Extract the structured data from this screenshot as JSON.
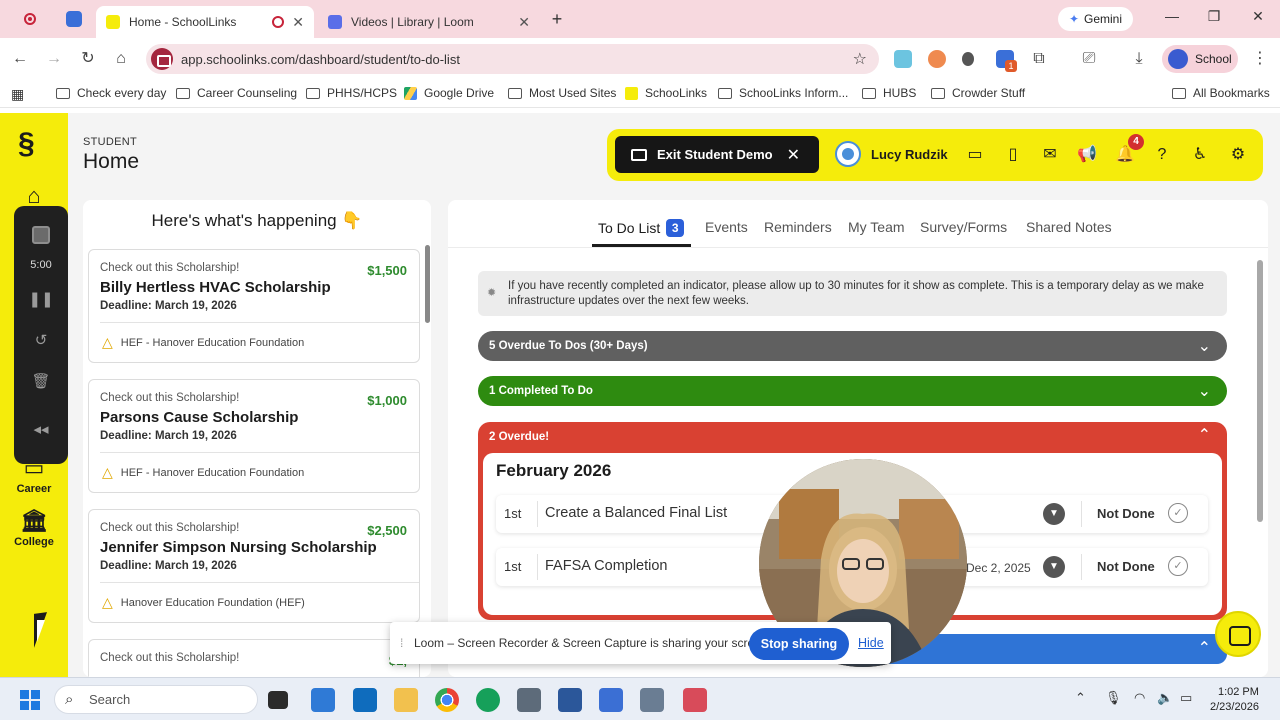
{
  "browser": {
    "tabs": [
      {
        "title": "Home - SchoolLinks",
        "active": true
      },
      {
        "title": "Videos | Library | Loom",
        "active": false
      }
    ],
    "gemini_label": "Gemini",
    "url": "app.schoolinks.com/dashboard/student/to-do-list",
    "profile_label": "School",
    "extension_badge": "1",
    "bookmarks": [
      "Check every day",
      "Career Counseling",
      "PHHS/HCPS",
      "Google Drive",
      "Most Used Sites",
      "SchooLinks",
      "SchooLinks Inform...",
      "HUBS",
      "Crowder Stuff"
    ],
    "all_bookmarks": "All Bookmarks"
  },
  "sidebar": {
    "items": [
      {
        "label": "Career",
        "icon": "briefcase-icon"
      },
      {
        "label": "College",
        "icon": "college-building-icon"
      }
    ]
  },
  "loom_controls": {
    "timer": "5:00"
  },
  "page": {
    "breadcrumb": "STUDENT",
    "title": "Home"
  },
  "topbar": {
    "exit_demo": "Exit Student Demo",
    "user_name": "Lucy Rudzik",
    "notification_count": "4"
  },
  "happening": {
    "heading": "Here's what's happening 👇",
    "cards": [
      {
        "kicker": "Check out this Scholarship!",
        "amount": "$1,500",
        "name": "Billy Hertless HVAC Scholarship",
        "deadline": "Deadline: March 19, 2026",
        "org": "HEF - Hanover Education Foundation"
      },
      {
        "kicker": "Check out this Scholarship!",
        "amount": "$1,000",
        "name": "Parsons Cause Scholarship",
        "deadline": "Deadline: March 19, 2026",
        "org": "HEF - Hanover Education Foundation"
      },
      {
        "kicker": "Check out this Scholarship!",
        "amount": "$2,500",
        "name": "Jennifer Simpson Nursing Scholarship",
        "deadline": "Deadline: March 19, 2026",
        "org": "Hanover Education Foundation (HEF)"
      },
      {
        "kicker": "Check out this Scholarship!",
        "amount": "$1,",
        "name": "",
        "deadline": "",
        "org": ""
      }
    ]
  },
  "todo": {
    "tabs": [
      "To Do List",
      "Events",
      "Reminders",
      "My Team",
      "Survey/Forms",
      "Shared Notes"
    ],
    "todo_count": "3",
    "notice": "If you have recently completed an indicator, please allow up to 30 minutes for it show as complete. This is a temporary delay as we make infrastructure updates over the next few weeks.",
    "overdue_30": "5 Overdue To Dos (30+ Days)",
    "completed": "1 Completed To Do",
    "overdue": "2 Overdue!",
    "month": "February 2026",
    "items": [
      {
        "day": "1st",
        "name": "Create a Balanced Final List",
        "due": "",
        "status": "Not Done"
      },
      {
        "day": "1st",
        "name": "FAFSA Completion",
        "due": "Dec 2, 2025",
        "status": "Not Done"
      }
    ]
  },
  "loom_banner": {
    "message": "Loom – Screen Recorder & Screen Capture is sharing your screen.",
    "stop": "Stop sharing",
    "hide": "Hide"
  },
  "taskbar": {
    "search": "Search",
    "time": "1:02 PM",
    "date": "2/23/2026"
  },
  "colors": {
    "brand_yellow": "#f5ec0b",
    "overdue_gray": "#606060",
    "completed_green": "#2e8b10",
    "overdue_red": "#d94132",
    "accent_blue": "#2f74d6"
  }
}
